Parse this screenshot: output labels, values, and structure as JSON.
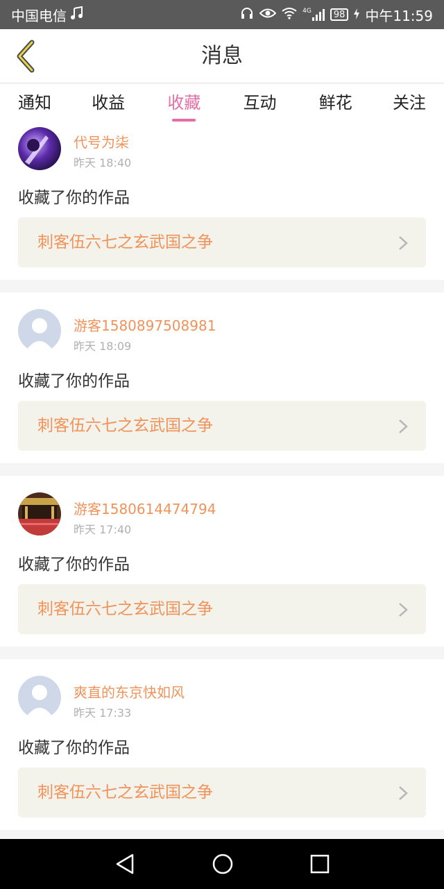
{
  "status_bar": {
    "carrier": "中国电信",
    "network": "4G",
    "battery": "98",
    "time": "中午11:59"
  },
  "header": {
    "title": "消息"
  },
  "tabs": [
    {
      "label": "通知",
      "active": false
    },
    {
      "label": "收益",
      "active": false
    },
    {
      "label": "收藏",
      "active": true
    },
    {
      "label": "互动",
      "active": false
    },
    {
      "label": "鲜花",
      "active": false
    },
    {
      "label": "关注",
      "active": false
    }
  ],
  "items": [
    {
      "user": "代号为柒",
      "time": "昨天 18:40",
      "action": "收藏了你的作品",
      "work": "刺客伍六七之玄武国之争",
      "avatar": "purple-art-avatar"
    },
    {
      "user": "游客1580897508981",
      "time": "昨天 18:09",
      "action": "收藏了你的作品",
      "work": "刺客伍六七之玄武国之争",
      "avatar": "default-avatar"
    },
    {
      "user": "游客1580614474794",
      "time": "昨天 17:40",
      "action": "收藏了你的作品",
      "work": "刺客伍六七之玄武国之争",
      "avatar": "temple-photo-avatar"
    },
    {
      "user": "爽直的东京快如风",
      "time": "昨天 17:33",
      "action": "收藏了你的作品",
      "work": "刺客伍六七之玄武国之争",
      "avatar": "default-avatar"
    }
  ],
  "colors": {
    "accent": "#e46ea6",
    "username": "#f0935a",
    "work_bg": "#f3f2eb",
    "status_bar": "#5a5a5a"
  }
}
